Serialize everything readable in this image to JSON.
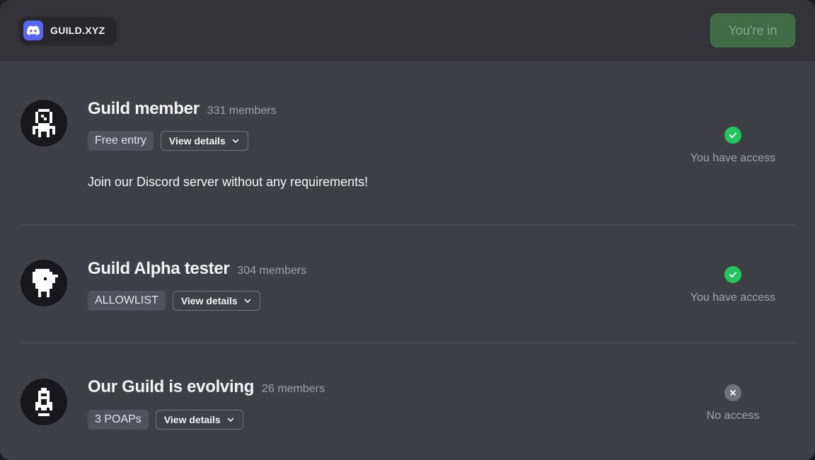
{
  "brand": {
    "name": "GUILD.XYZ",
    "logo_icon": "discord-icon",
    "logo_color": "#5865f2"
  },
  "header": {
    "join_label": "You're in",
    "join_color": "#3f6b45"
  },
  "roles": [
    {
      "name": "Guild member",
      "members": "331 members",
      "tag": "Free entry",
      "details_label": "View details",
      "description": "Join our Discord server without any requirements!",
      "access": "You have access",
      "has_access": true,
      "avatar_icon": "astronaut-icon"
    },
    {
      "name": "Guild Alpha tester",
      "members": "304 members",
      "tag": "ALLOWLIST",
      "details_label": "View details",
      "description": "",
      "access": "You have access",
      "has_access": true,
      "avatar_icon": "bird-icon"
    },
    {
      "name": "Our Guild is evolving",
      "members": "26 members",
      "tag": "3 POAPs",
      "details_label": "View details",
      "description": "",
      "access": "No access",
      "has_access": false,
      "avatar_icon": "rocket-icon"
    }
  ],
  "colors": {
    "access_granted": "#22c55e",
    "access_denied": "#71717a"
  }
}
